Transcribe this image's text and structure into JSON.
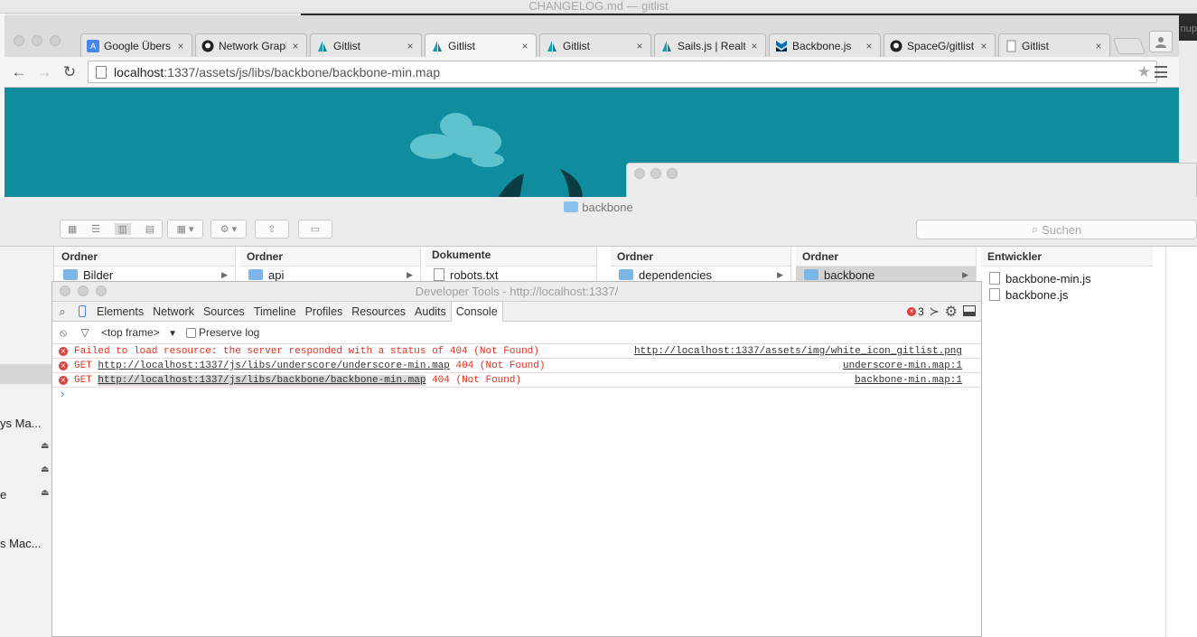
{
  "background_window": {
    "title": "CHANGELOG.md — gitlist",
    "right_fragment": "nup"
  },
  "browser": {
    "tabs": [
      {
        "label": "Google Übers",
        "icon": "google-translate-icon"
      },
      {
        "label": "Network Grapl",
        "icon": "github-icon"
      },
      {
        "label": "Gitlist",
        "icon": "sails-icon"
      },
      {
        "label": "Gitlist",
        "icon": "sails-icon"
      },
      {
        "label": "Gitlist",
        "icon": "sails-icon"
      },
      {
        "label": "Sails.js | Realt",
        "icon": "sails-icon"
      },
      {
        "label": "Backbone.js",
        "icon": "backbone-icon"
      },
      {
        "label": "SpaceG/gitlist",
        "icon": "github-icon"
      },
      {
        "label": "Gitlist",
        "icon": "page-icon"
      }
    ],
    "url_host": "localhost",
    "url_path": ":1337/assets/js/libs/backbone/backbone-min.map"
  },
  "finder": {
    "title": "backbone",
    "search_placeholder": "Suchen",
    "sidebar_items": [
      {
        "label": "ys Ma..."
      },
      {
        "label": "e"
      },
      {
        "label": "s Mac..."
      }
    ],
    "columns": [
      {
        "header": "Ordner",
        "rows": [
          {
            "label": "Bilder",
            "type": "folder"
          }
        ]
      },
      {
        "header": "Ordner",
        "rows": [
          {
            "label": "api",
            "type": "folder"
          }
        ]
      },
      {
        "header": "Dokumente",
        "rows": [
          {
            "label": "robots.txt",
            "type": "file"
          }
        ]
      },
      {
        "header": "Ordner",
        "rows": [
          {
            "label": "dependencies",
            "type": "folder"
          }
        ]
      },
      {
        "header": "Ordner",
        "rows": [
          {
            "label": "backbone",
            "type": "folder"
          }
        ]
      },
      {
        "header": "Entwickler",
        "rows": [
          {
            "label": "backbone-min.js",
            "type": "file"
          },
          {
            "label": "backbone.js",
            "type": "file"
          }
        ]
      }
    ]
  },
  "devtools": {
    "title": "Developer Tools - http://localhost:1337/",
    "tabs": [
      "Elements",
      "Network",
      "Sources",
      "Timeline",
      "Profiles",
      "Resources",
      "Audits",
      "Console"
    ],
    "active_tab": "Console",
    "error_count": "3",
    "frame_select": "<top frame>",
    "preserve_log_label": "Preserve log",
    "messages": [
      {
        "prefix": "Failed to load resource: the server responded with a status of 404 (Not Found)",
        "link": "",
        "suffix": "",
        "source": "http://localhost:1337/assets/img/white_icon_gitlist.png"
      },
      {
        "prefix": "GET ",
        "link": "http://localhost:1337/js/libs/underscore/underscore-min.map",
        "suffix": " 404 (Not Found)",
        "source": "underscore-min.map:1"
      },
      {
        "prefix": "GET ",
        "link": "http://localhost:1337/js/libs/backbone/backbone-min.map",
        "suffix": " 404 (Not Found)",
        "source": "backbone-min.map:1"
      }
    ],
    "prompt": "›"
  },
  "colors": {
    "page_teal": "#108c9f",
    "error_red": "#e0301e"
  }
}
